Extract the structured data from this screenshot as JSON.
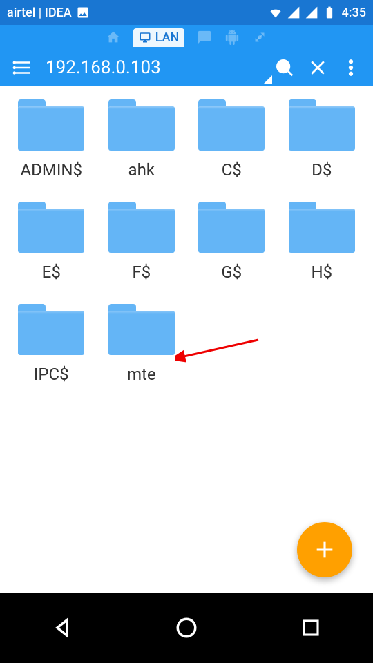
{
  "status": {
    "carrier": "airtel | IDEA",
    "time": "4:35"
  },
  "tabs": {
    "lan_label": "LAN"
  },
  "toolbar": {
    "address": "192.168.0.103"
  },
  "folders": [
    {
      "name": "ADMIN$"
    },
    {
      "name": "ahk"
    },
    {
      "name": "C$"
    },
    {
      "name": "D$"
    },
    {
      "name": "E$"
    },
    {
      "name": "F$"
    },
    {
      "name": "G$"
    },
    {
      "name": "H$"
    },
    {
      "name": "IPC$"
    },
    {
      "name": "mte"
    }
  ]
}
